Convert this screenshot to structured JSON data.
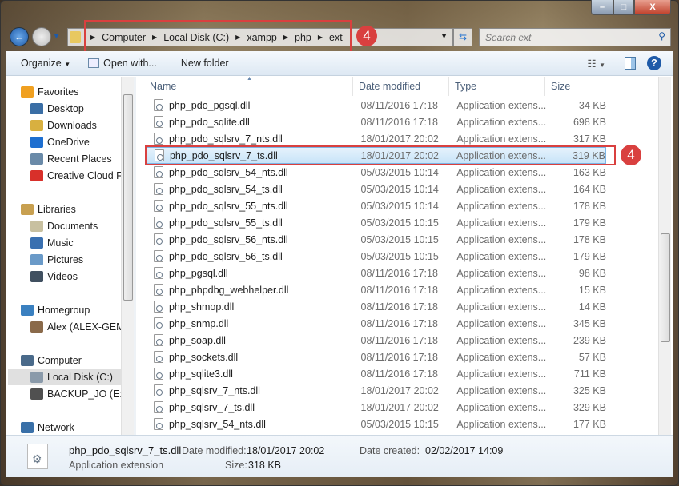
{
  "window": {
    "minimize": "–",
    "maximize": "□",
    "close": "X"
  },
  "address": {
    "crumbs": [
      "Computer",
      "Local Disk (C:)",
      "xampp",
      "php",
      "ext"
    ]
  },
  "search": {
    "placeholder": "Search ext"
  },
  "toolbar": {
    "organize": "Organize",
    "open_with": "Open with...",
    "new_folder": "New folder"
  },
  "sidebar": {
    "items": [
      {
        "label": "Favorites",
        "icon": "star-icon",
        "color": "#f0a020",
        "group": true
      },
      {
        "label": "Desktop",
        "icon": "desktop-icon",
        "color": "#3a6ea5"
      },
      {
        "label": "Downloads",
        "icon": "downloads-icon",
        "color": "#d8b040"
      },
      {
        "label": "OneDrive",
        "icon": "onedrive-icon",
        "color": "#1e6fd0"
      },
      {
        "label": "Recent Places",
        "icon": "recent-places-icon",
        "color": "#6a8aa8"
      },
      {
        "label": "Creative Cloud Files",
        "icon": "creative-cloud-icon",
        "color": "#d8302a"
      },
      {
        "label": "Libraries",
        "icon": "libraries-icon",
        "color": "#c8a050",
        "group": true
      },
      {
        "label": "Documents",
        "icon": "documents-icon",
        "color": "#c8c0a0"
      },
      {
        "label": "Music",
        "icon": "music-icon",
        "color": "#3a70b0"
      },
      {
        "label": "Pictures",
        "icon": "pictures-icon",
        "color": "#6a9ac8"
      },
      {
        "label": "Videos",
        "icon": "videos-icon",
        "color": "#405060"
      },
      {
        "label": "Homegroup",
        "icon": "homegroup-icon",
        "color": "#3a80c0",
        "group": true
      },
      {
        "label": "Alex (ALEX-GEM-",
        "icon": "user-icon",
        "color": "#8a6a4a"
      },
      {
        "label": "Computer",
        "icon": "computer-icon",
        "color": "#4a6a8a",
        "group": true
      },
      {
        "label": "Local Disk (C:)",
        "icon": "drive-icon",
        "color": "#8a9aaa",
        "selected": true
      },
      {
        "label": "BACKUP_JO (E:)",
        "icon": "usb-drive-icon",
        "color": "#505050"
      },
      {
        "label": "Network",
        "icon": "network-icon",
        "color": "#3a70a8",
        "group": true
      }
    ]
  },
  "columns": {
    "name": "Name",
    "date": "Date modified",
    "type": "Type",
    "size": "Size"
  },
  "files": [
    {
      "name": "php_pdo_pgsql.dll",
      "date": "08/11/2016 17:18",
      "type": "Application extens...",
      "size": "34 KB"
    },
    {
      "name": "php_pdo_sqlite.dll",
      "date": "08/11/2016 17:18",
      "type": "Application extens...",
      "size": "698 KB"
    },
    {
      "name": "php_pdo_sqlsrv_7_nts.dll",
      "date": "18/01/2017 20:02",
      "type": "Application extens...",
      "size": "317 KB"
    },
    {
      "name": "php_pdo_sqlsrv_7_ts.dll",
      "date": "18/01/2017 20:02",
      "type": "Application extens...",
      "size": "319 KB",
      "selected": true
    },
    {
      "name": "php_pdo_sqlsrv_54_nts.dll",
      "date": "05/03/2015 10:14",
      "type": "Application extens...",
      "size": "163 KB"
    },
    {
      "name": "php_pdo_sqlsrv_54_ts.dll",
      "date": "05/03/2015 10:14",
      "type": "Application extens...",
      "size": "164 KB"
    },
    {
      "name": "php_pdo_sqlsrv_55_nts.dll",
      "date": "05/03/2015 10:14",
      "type": "Application extens...",
      "size": "178 KB"
    },
    {
      "name": "php_pdo_sqlsrv_55_ts.dll",
      "date": "05/03/2015 10:15",
      "type": "Application extens...",
      "size": "179 KB"
    },
    {
      "name": "php_pdo_sqlsrv_56_nts.dll",
      "date": "05/03/2015 10:15",
      "type": "Application extens...",
      "size": "178 KB"
    },
    {
      "name": "php_pdo_sqlsrv_56_ts.dll",
      "date": "05/03/2015 10:15",
      "type": "Application extens...",
      "size": "179 KB"
    },
    {
      "name": "php_pgsql.dll",
      "date": "08/11/2016 17:18",
      "type": "Application extens...",
      "size": "98 KB"
    },
    {
      "name": "php_phpdbg_webhelper.dll",
      "date": "08/11/2016 17:18",
      "type": "Application extens...",
      "size": "15 KB"
    },
    {
      "name": "php_shmop.dll",
      "date": "08/11/2016 17:18",
      "type": "Application extens...",
      "size": "14 KB"
    },
    {
      "name": "php_snmp.dll",
      "date": "08/11/2016 17:18",
      "type": "Application extens...",
      "size": "345 KB"
    },
    {
      "name": "php_soap.dll",
      "date": "08/11/2016 17:18",
      "type": "Application extens...",
      "size": "239 KB"
    },
    {
      "name": "php_sockets.dll",
      "date": "08/11/2016 17:18",
      "type": "Application extens...",
      "size": "57 KB"
    },
    {
      "name": "php_sqlite3.dll",
      "date": "08/11/2016 17:18",
      "type": "Application extens...",
      "size": "711 KB"
    },
    {
      "name": "php_sqlsrv_7_nts.dll",
      "date": "18/01/2017 20:02",
      "type": "Application extens...",
      "size": "325 KB"
    },
    {
      "name": "php_sqlsrv_7_ts.dll",
      "date": "18/01/2017 20:02",
      "type": "Application extens...",
      "size": "329 KB"
    },
    {
      "name": "php_sqlsrv_54_nts.dll",
      "date": "05/03/2015 10:15",
      "type": "Application extens...",
      "size": "177 KB"
    }
  ],
  "details": {
    "name": "php_pdo_sqlsrv_7_ts.dll",
    "type": "Application extension",
    "date_modified_label": "Date modified:",
    "date_modified": "18/01/2017 20:02",
    "date_created_label": "Date created:",
    "date_created": "02/02/2017 14:09",
    "size_label": "Size:",
    "size": "318 KB"
  },
  "annotations": {
    "step": "4",
    "color": "#d9403f"
  }
}
